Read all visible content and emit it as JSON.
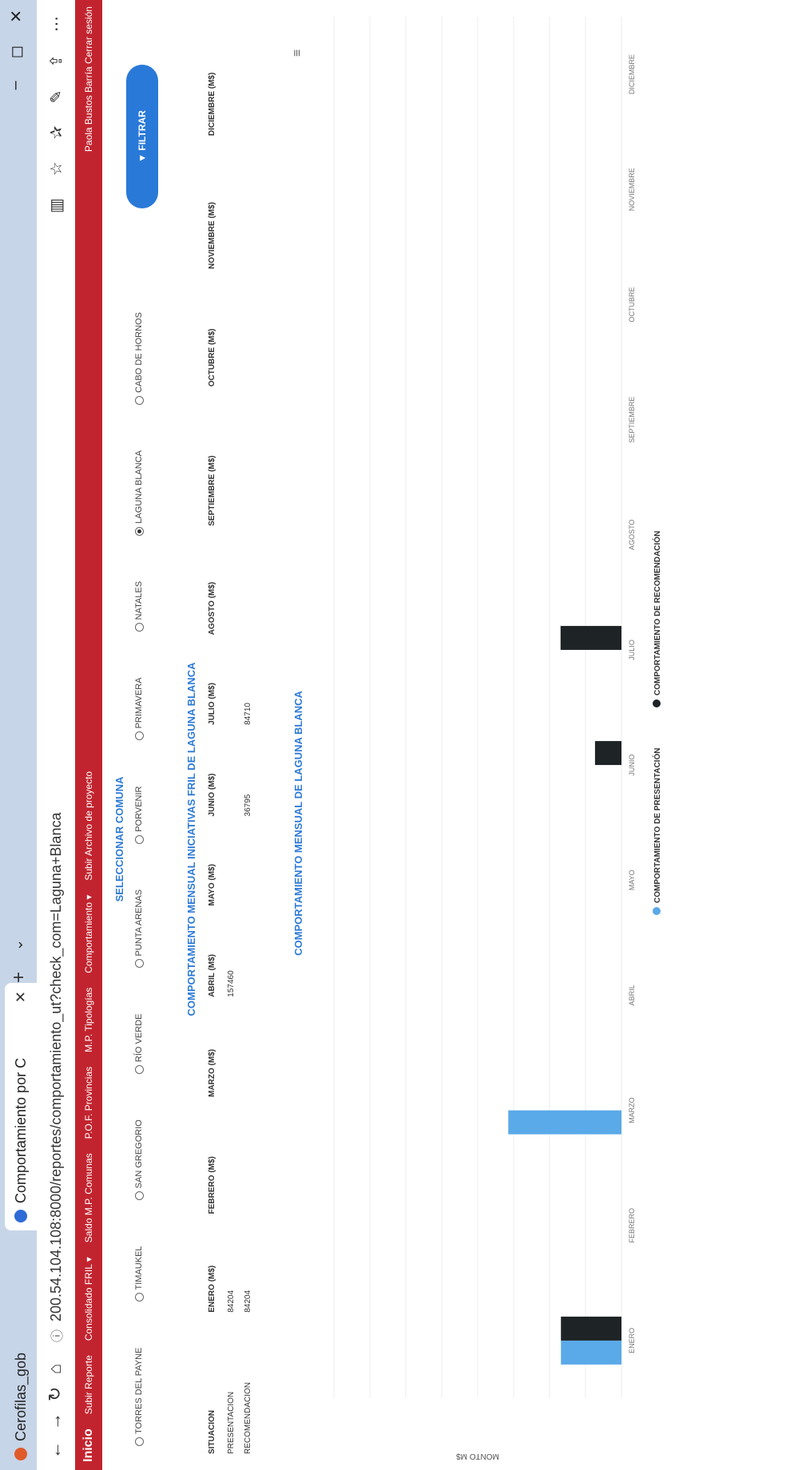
{
  "browser": {
    "tabs": [
      {
        "label": "Cerofilas_gob"
      },
      {
        "label": "Comportamiento por C"
      }
    ],
    "url": "200.54.104.108:8000/reportes/comportamiento_ut?check_com=Laguna+Blanca",
    "new_tab": "+",
    "tab_menu": "⌄",
    "window_controls": [
      "–",
      "◻",
      "✕"
    ]
  },
  "appbar": {
    "items": [
      "Inicio",
      "Subir Reporte",
      "Consolidado FRIL ▾",
      "Saldo M.P. Comunas",
      "P.O.F. Provincias",
      "M.P. Tipologías",
      "Comportamiento ▾",
      "Subir Archivo de proyecto"
    ],
    "right": "Paola Bustos Barría  Cerrar sesión"
  },
  "selector": {
    "title": "SELECCIONAR COMUNA",
    "options": [
      "TORRES DEL PAYNE",
      "TIMAUKEL",
      "SAN GREGORIO",
      "RÍO VERDE",
      "PUNTA ARENAS",
      "PORVENIR",
      "PRIMAVERA",
      "NATALES",
      "LAGUNA BLANCA",
      "CABO DE HORNOS"
    ],
    "selected": "LAGUNA BLANCA",
    "button": "▼ FILTRAR"
  },
  "table": {
    "title": "COMPORTAMIENTO MENSUAL INICIATIVAS FRIL DE LAGUNA BLANCA",
    "headers": [
      "SITUACION",
      "ENERO (M$)",
      "FEBRERO (M$)",
      "MARZO (M$)",
      "ABRIL (M$)",
      "MAYO (M$)",
      "JUNIO (M$)",
      "JULIO (M$)",
      "AGOSTO (M$)",
      "SEPTIEMBRE (M$)",
      "OCTUBRE (M$)",
      "NOVIEMBRE (M$)",
      "DICIEMBRE (M$)"
    ],
    "rows": [
      [
        "PRESENTACION",
        "84204",
        "",
        "",
        "157460",
        "",
        "",
        "",
        "",
        "",
        "",
        "",
        ""
      ],
      [
        "RECOMENDACION",
        "84204",
        "",
        "",
        "",
        "",
        "36795",
        "84710",
        "",
        "",
        "",
        "",
        ""
      ]
    ]
  },
  "chart_data": {
    "type": "bar",
    "title": "COMPORTAMIENTO MENSUAL DE LAGUNA BLANCA",
    "ylabel": "MONTO M$",
    "categories": [
      "ENERO",
      "FEBRERO",
      "MARZO",
      "ABRIL",
      "MAYO",
      "JUNIO",
      "JULIO",
      "AGOSTO",
      "SEPTIEMBRE",
      "OCTUBRE",
      "NOVIEMBRE",
      "DICIEMBRE"
    ],
    "series": [
      {
        "name": "COMPORTAMIENTO DE PRESENTACIÓN",
        "color": "#5aa9e8",
        "values": [
          84204,
          0,
          157460,
          0,
          0,
          0,
          0,
          0,
          0,
          0,
          0,
          0
        ]
      },
      {
        "name": "COMPORTAMIENTO DE RECOMENDACIÓN",
        "color": "#1e2326",
        "values": [
          84204,
          0,
          0,
          0,
          0,
          36795,
          84710,
          0,
          0,
          0,
          0,
          0
        ]
      }
    ],
    "ylim": [
      0,
      400000
    ],
    "legend": "bottom"
  }
}
